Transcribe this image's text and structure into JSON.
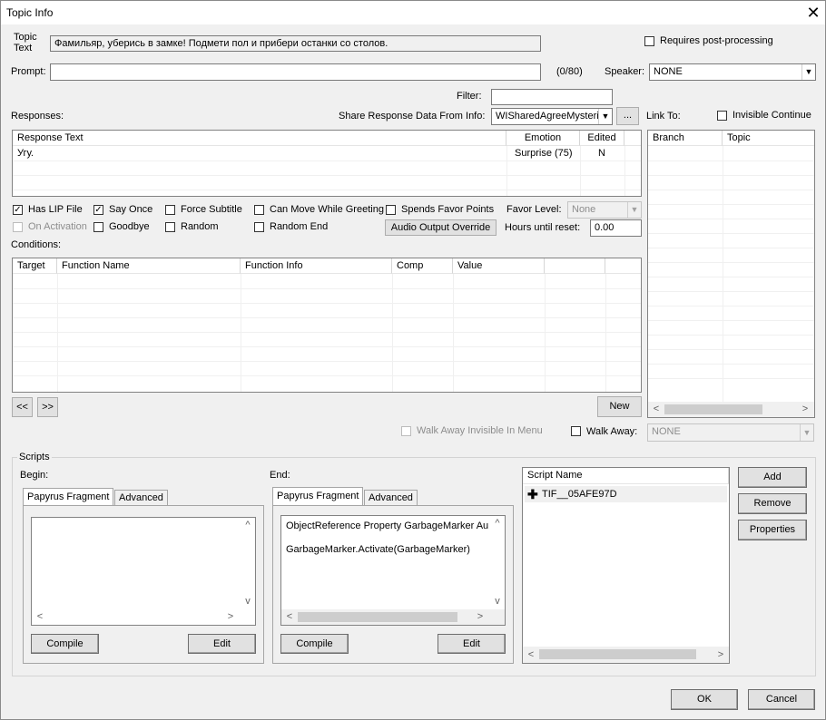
{
  "window": {
    "title": "Topic Info"
  },
  "topic_text": {
    "label_line1": "Topic",
    "label_line2": "Text",
    "value": "Фамильяр, уберись в замке! Подмети пол и прибери останки со столов."
  },
  "requires_post_processing": {
    "label": "Requires post-processing",
    "checked": false
  },
  "prompt": {
    "label": "Prompt:",
    "value": "",
    "count": "(0/80)"
  },
  "speaker": {
    "label": "Speaker:",
    "value": "NONE"
  },
  "filter": {
    "label": "Filter:",
    "value": ""
  },
  "responses": {
    "label": "Responses:",
    "share_label": "Share Response Data From Info:",
    "share_value": "WISharedAgreeMysteri",
    "share_button": "...",
    "columns": [
      "Response Text",
      "Emotion",
      "Edited"
    ],
    "rows": [
      {
        "text": "Угу.",
        "emotion": "Surprise (75)",
        "edited": "N"
      }
    ]
  },
  "link_to": {
    "label": "Link To:",
    "invisible_continue": {
      "label": "Invisible Continue",
      "checked": false
    },
    "columns": [
      "Branch",
      "Topic"
    ]
  },
  "flags": {
    "has_lip_file": {
      "label": "Has LIP File",
      "checked": true
    },
    "say_once": {
      "label": "Say Once",
      "checked": true
    },
    "force_subtitle": {
      "label": "Force Subtitle",
      "checked": false
    },
    "can_move_while_greeting": {
      "label": "Can Move While Greeting",
      "checked": false
    },
    "spends_favor_points": {
      "label": "Spends Favor Points",
      "checked": false
    },
    "favor_level": {
      "label": "Favor Level:",
      "value": "None"
    },
    "on_activation": {
      "label": "On Activation",
      "checked": false
    },
    "goodbye": {
      "label": "Goodbye",
      "checked": false
    },
    "random": {
      "label": "Random",
      "checked": false
    },
    "random_end": {
      "label": "Random End",
      "checked": false
    },
    "audio_output_override": "Audio Output Override",
    "hours_until_reset": {
      "label": "Hours until reset:",
      "value": "0.00"
    }
  },
  "conditions": {
    "label": "Conditions:",
    "columns": [
      "Target",
      "Function Name",
      "Function Info",
      "Comp",
      "Value"
    ],
    "prev_button": "<<",
    "next_button": ">>",
    "new_button": "New"
  },
  "walk_away_invisible": {
    "label": "Walk Away Invisible In Menu",
    "checked": false
  },
  "walk_away": {
    "label": "Walk Away:",
    "checked": false,
    "value": "NONE"
  },
  "scripts": {
    "group_label": "Scripts",
    "begin": {
      "label": "Begin:",
      "tab_fragment": "Papyrus Fragment",
      "tab_advanced": "Advanced",
      "compile": "Compile",
      "edit": "Edit"
    },
    "end": {
      "label": "End:",
      "tab_fragment": "Papyrus Fragment",
      "tab_advanced": "Advanced",
      "line1": "ObjectReference Property GarbageMarker  Au",
      "line2": "GarbageMarker.Activate(GarbageMarker)",
      "compile": "Compile",
      "edit": "Edit"
    },
    "list_header": "Script Name",
    "items": [
      "TIF__05AFE97D"
    ],
    "add": "Add",
    "remove": "Remove",
    "properties": "Properties"
  },
  "ok": "OK",
  "cancel": "Cancel"
}
